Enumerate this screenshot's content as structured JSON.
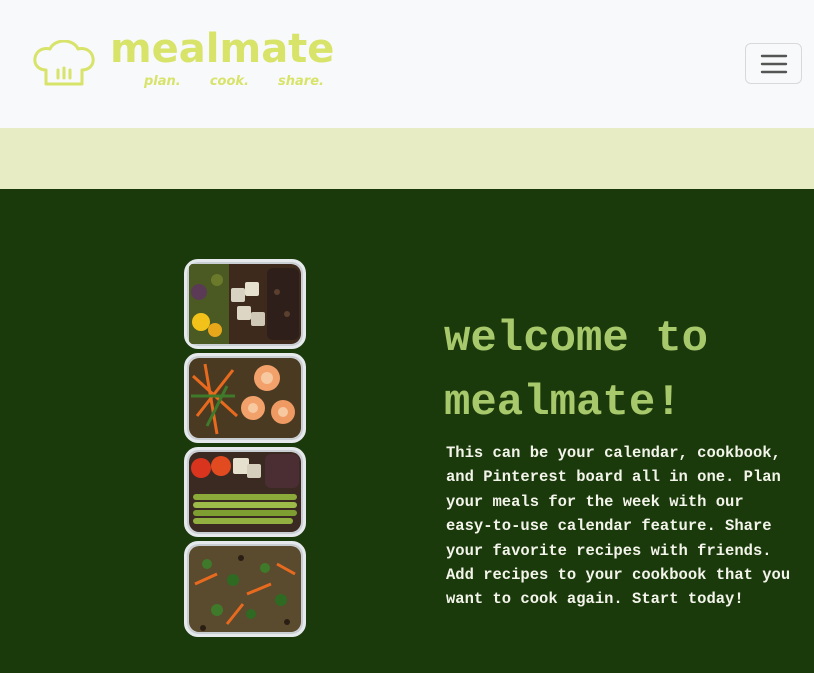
{
  "navbar": {
    "brand_name": "mealmate",
    "tagline": [
      "plan.",
      "cook.",
      "share."
    ],
    "logo_icon": "chef-hat-icon",
    "toggle_icon": "hamburger-menu-icon"
  },
  "hero": {
    "title": "welcome to mealmate!",
    "description": "This can be your calendar, cookbook, and Pinterest board all in one. Plan your meals for the week with our easy-to-use calendar feature. Share your favorite recipes with friends. Add recipes to your cookbook that you want to cook again. Start today!",
    "image_alt": "meal prep containers"
  },
  "colors": {
    "brand": "#d8e36a",
    "navbar_bg": "#f8f9fa",
    "band_bg": "#e8ecc4",
    "hero_bg": "#1b3a0c",
    "hero_title": "#a7c96b",
    "hero_text": "#f3f4ea"
  }
}
